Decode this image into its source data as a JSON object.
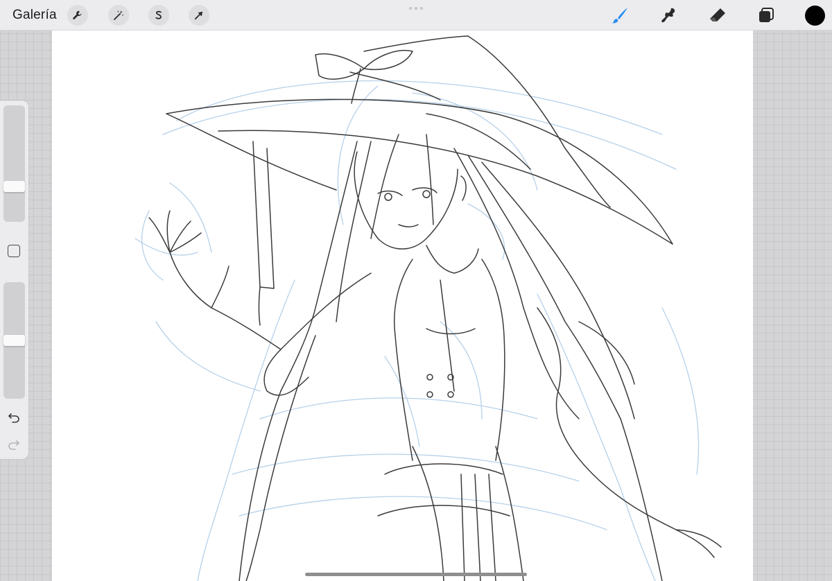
{
  "topbar": {
    "gallery_label": "Galería",
    "tools_left": [
      {
        "name": "actions",
        "icon": "wrench-icon"
      },
      {
        "name": "adjustments",
        "icon": "magic-wand-icon"
      },
      {
        "name": "selection",
        "icon": "selection-s-icon"
      },
      {
        "name": "transform",
        "icon": "arrow-cursor-icon"
      }
    ],
    "tools_right": [
      {
        "name": "brush",
        "icon": "brush-icon",
        "active": true
      },
      {
        "name": "smudge",
        "icon": "smudge-icon"
      },
      {
        "name": "eraser",
        "icon": "eraser-icon"
      },
      {
        "name": "layers",
        "icon": "layers-icon"
      }
    ],
    "current_color": "#000000",
    "active_tool_color": "#2a8ef0"
  },
  "sidebar": {
    "brush_size_level": 0.28,
    "opacity_level": 0.5,
    "modifier_icon": "square-modifier-icon",
    "undo_icon": "undo-icon",
    "redo_icon": "redo-icon"
  },
  "canvas": {
    "content": "sketch",
    "sketch_color_primary": "#3a3a3a",
    "sketch_color_secondary": "#a9c8e6"
  }
}
